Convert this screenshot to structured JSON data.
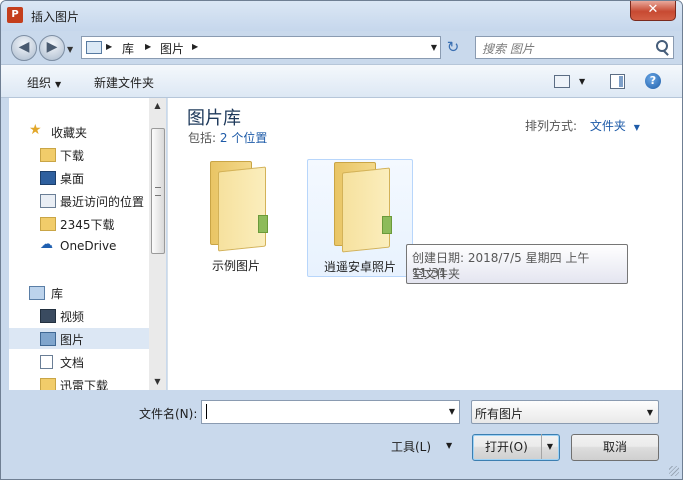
{
  "window": {
    "title": "插入图片",
    "app_icon_letter": "P",
    "close_glyph": "✕"
  },
  "nav": {
    "back_glyph": "◀",
    "forward_glyph": "▶",
    "breadcrumb": [
      "库",
      "图片"
    ],
    "refresh_glyph": "↻",
    "search_placeholder": "搜索 图片"
  },
  "toolbar": {
    "organize": "组织",
    "new_folder": "新建文件夹",
    "help": "?"
  },
  "sidebar": {
    "favorites": [
      {
        "label": "收藏夹",
        "icon": "star-icon"
      },
      {
        "label": "下载",
        "icon": "download-folder-icon"
      },
      {
        "label": "桌面",
        "icon": "desktop-icon"
      },
      {
        "label": "最近访问的位置",
        "icon": "recent-places-icon"
      },
      {
        "label": "2345下载",
        "icon": "folder-icon"
      },
      {
        "label": "OneDrive",
        "icon": "onedrive-icon"
      }
    ],
    "libraries": [
      {
        "label": "库",
        "icon": "library-icon"
      },
      {
        "label": "视频",
        "icon": "video-library-icon"
      },
      {
        "label": "图片",
        "icon": "pictures-library-icon",
        "selected": true
      },
      {
        "label": "文档",
        "icon": "documents-library-icon"
      },
      {
        "label": "迅雷下载",
        "icon": "folder-icon"
      }
    ]
  },
  "content": {
    "library_title": "图片库",
    "includes_prefix": "包括:",
    "includes_link": "2 个位置",
    "arrange_label": "排列方式:",
    "arrange_value": "文件夹",
    "folders": [
      {
        "name": "示例图片"
      },
      {
        "name": "逍遥安卓照片"
      }
    ],
    "tooltip": {
      "line1": "创建日期: 2018/7/5 星期四 上午 11:31",
      "line2": "空文件夹"
    }
  },
  "footer": {
    "filename_label": "文件名(N):",
    "filename_value": "",
    "file_type": "所有图片",
    "tools_label": "工具(L)",
    "open_label": "打开(O)",
    "cancel_label": "取消"
  },
  "colors": {
    "accent_link": "#1e5ba8",
    "title_blue": "#1e395b",
    "selection": "#dce7f4"
  }
}
